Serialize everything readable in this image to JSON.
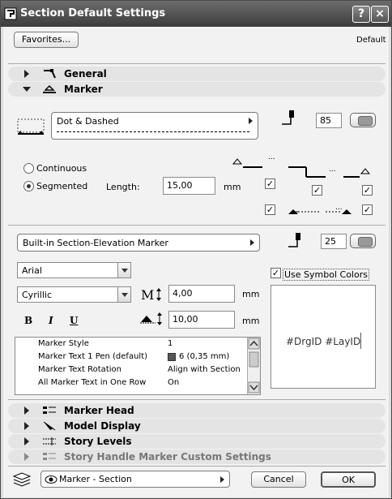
{
  "window": {
    "title": "Section Default Settings",
    "help_label": "?",
    "close_label": "×"
  },
  "header": {
    "favorites_label": "Favorites...",
    "default_label": "Default"
  },
  "sections": {
    "general": "General",
    "marker": "Marker",
    "marker_head": "Marker Head",
    "model_display": "Model Display",
    "story_levels": "Story Levels",
    "story_handle": "Story Handle Marker Custom Settings"
  },
  "marker": {
    "line_type": "Dot & Dashed",
    "pen_value": "85",
    "continuous_label": "Continuous",
    "segmented_label": "Segmented",
    "mode": "segmented",
    "length_label": "Length:",
    "length_value": "15,00",
    "length_unit": "mm",
    "marker_type": "Built-in Section-Elevation Marker",
    "marker_pen_value": "25",
    "font": "Arial",
    "script": "Cyrillic",
    "font_size_value": "4,00",
    "font_size_unit": "mm",
    "offset_value": "10,00",
    "offset_unit": "mm",
    "bold_label": "B",
    "italic_label": "I",
    "underline_label": "U",
    "use_symbol_colors_label": "Use Symbol Colors",
    "use_symbol_colors_checked": true,
    "preview_text": "#DrgID #LayID",
    "ellipsis_1": "...",
    "ellipsis_2": "...",
    "ellipsis_3": "..."
  },
  "properties": [
    {
      "key": "Marker Style",
      "value": "1"
    },
    {
      "key": "Marker Text 1 Pen (default)",
      "value": "6 (0,35 mm)"
    },
    {
      "key": "Marker Text Rotation",
      "value": "Align with Section"
    },
    {
      "key": "All Marker Text in One Row",
      "value": "On"
    }
  ],
  "footer": {
    "layer": "Marker - Section",
    "cancel_label": "Cancel",
    "ok_label": "OK"
  },
  "colors": {
    "titlebar": "#4a4a4a",
    "panel": "#f2f2f2",
    "pen_swatch": "#555555"
  }
}
